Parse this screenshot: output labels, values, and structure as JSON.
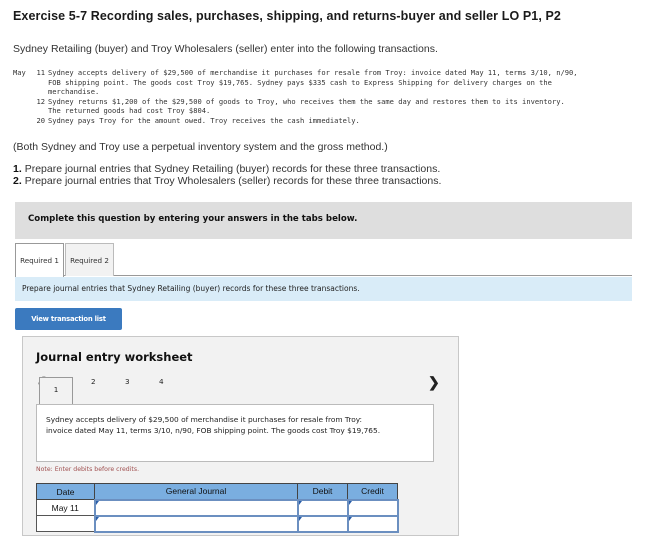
{
  "page": {
    "title": "Exercise 5-7 Recording sales, purchases, shipping, and returns-buyer and seller LO P1, P2",
    "intro": "Sydney Retailing (buyer) and Troy Wholesalers (seller) enter into the following transactions."
  },
  "transactions": [
    {
      "month": "May",
      "day": "11",
      "lines": [
        "Sydney accepts delivery of $29,500 of merchandise it purchases for resale from Troy: invoice dated May 11, terms 3/10, n/90,",
        "FOB shipping point. The goods cost Troy $19,765. Sydney pays $335 cash to Express Shipping for delivery charges on the",
        "merchandise."
      ]
    },
    {
      "month": "",
      "day": "12",
      "lines": [
        "Sydney returns $1,200 of the $29,500 of goods to Troy, who receives them the same day and restores them to its inventory.",
        "The returned goods had cost Troy $804."
      ]
    },
    {
      "month": "",
      "day": "20",
      "lines": [
        "Sydney pays Troy for the amount owed. Troy receives the cash immediately."
      ]
    }
  ],
  "method_note": "(Both Sydney and Troy use a perpetual inventory system and the gross method.)",
  "requirements": [
    {
      "num": "1.",
      "text": "Prepare journal entries that Sydney Retailing (buyer) records for these three transactions."
    },
    {
      "num": "2.",
      "text": "Prepare journal entries that Troy Wholesalers (seller) records for these three transactions."
    }
  ],
  "highlight_color": "#ffff1a",
  "question_bar": "Complete this question by entering your answers in the tabs below.",
  "tabs": [
    {
      "label": "Required 1",
      "active": true
    },
    {
      "label": "Required 2",
      "active": false
    }
  ],
  "required_description": "Prepare journal entries that Sydney Retailing (buyer) records for these three transactions.",
  "view_transaction_button": "View transaction list",
  "worksheet": {
    "title": "Journal entry worksheet",
    "prev_icon": "chevron-left-icon",
    "next_icon": "chevron-right-icon",
    "steps": [
      "1",
      "2",
      "3",
      "4"
    ],
    "active_step": "1",
    "description": "Sydney accepts delivery of $29,500 of merchandise it purchases for resale from Troy: invoice dated May 11, terms 3/10, n/90, FOB shipping point. The goods cost Troy $19,765.",
    "note": "Note: Enter debits before credits.",
    "table": {
      "headers": [
        "Date",
        "General Journal",
        "Debit",
        "Credit"
      ],
      "rows": [
        {
          "date": "May 11",
          "account": "",
          "debit": "",
          "credit": ""
        },
        {
          "date": "",
          "account": "",
          "debit": "",
          "credit": ""
        }
      ]
    }
  },
  "colors": {
    "button_blue": "#3b7abf",
    "table_header_blue": "#7aaee0",
    "description_bg": "#d9ecf8",
    "question_bar_bg": "#dedede",
    "note_color": "#a05050"
  }
}
